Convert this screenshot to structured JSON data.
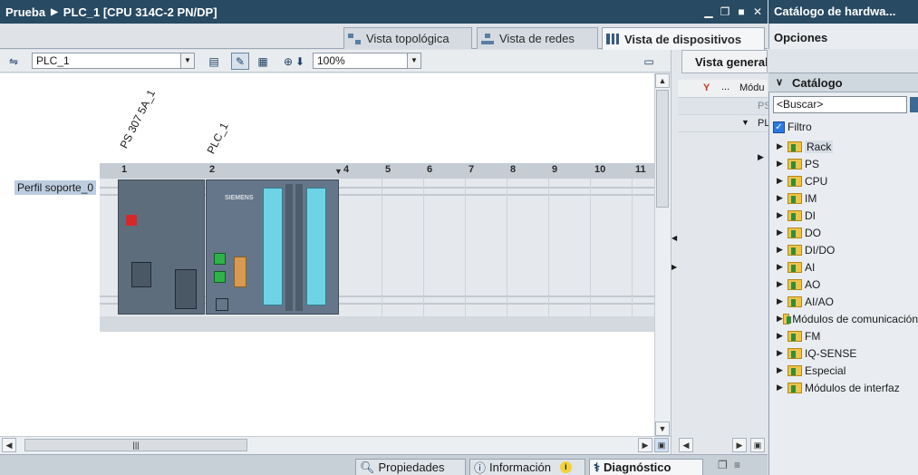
{
  "window": {
    "project": "Prueba",
    "device_title": "PLC_1 [CPU 314C-2 PN/DP]"
  },
  "view_tabs": [
    {
      "label": "Vista topológica"
    },
    {
      "label": "Vista de redes"
    },
    {
      "label": "Vista de dispositivos"
    }
  ],
  "toolbar": {
    "device_select": "PLC_1",
    "zoom_select": "100%"
  },
  "rack": {
    "label": "Perfil soporte_0",
    "slot_numbers": [
      "1",
      "2",
      "4",
      "5",
      "6",
      "7",
      "8",
      "9",
      "10",
      "11"
    ],
    "module_labels": [
      "PS 307 5A_1",
      "PLC_1"
    ],
    "brand": "SIEMENS"
  },
  "overview": {
    "tab_label": "Vista general",
    "column_label": "Módu",
    "row_labels": [
      "PS",
      "PL"
    ]
  },
  "bottom_tabs": [
    {
      "label": "Propiedades"
    },
    {
      "label": "Información"
    },
    {
      "label": "Diagnóstico"
    }
  ],
  "catalog": {
    "title": "Catálogo de hardwa...",
    "options_label": "Opciones",
    "section_label": "Catálogo",
    "search_value": "<Buscar>",
    "filter_label": "Filtro",
    "items": [
      {
        "label": "Rack"
      },
      {
        "label": "PS"
      },
      {
        "label": "CPU"
      },
      {
        "label": "IM"
      },
      {
        "label": "DI"
      },
      {
        "label": "DO"
      },
      {
        "label": "DI/DO"
      },
      {
        "label": "AI"
      },
      {
        "label": "AO"
      },
      {
        "label": "AI/AO"
      },
      {
        "label": "Módulos de comunicación"
      },
      {
        "label": "FM"
      },
      {
        "label": "IQ-SENSE"
      },
      {
        "label": "Especial"
      },
      {
        "label": "Módulos de interfaz"
      }
    ]
  },
  "colors": {
    "title_bar": "#284a63",
    "selection_blue": "#bccde0",
    "module_gray": "#5e6d7b",
    "io_cyan": "#6fd3e6"
  }
}
